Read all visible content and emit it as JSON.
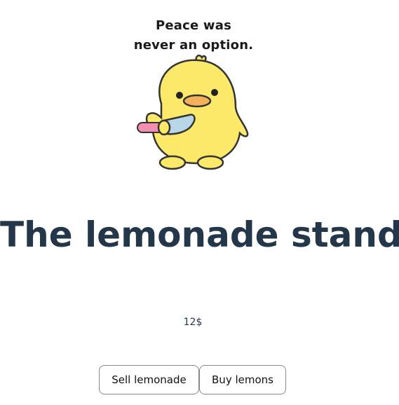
{
  "meme": {
    "line1": "Peace was",
    "line2": "never an option."
  },
  "title": "The lemonade stand",
  "money": "12$",
  "buttons": {
    "sell": "Sell lemonade",
    "buy": "Buy lemons"
  }
}
